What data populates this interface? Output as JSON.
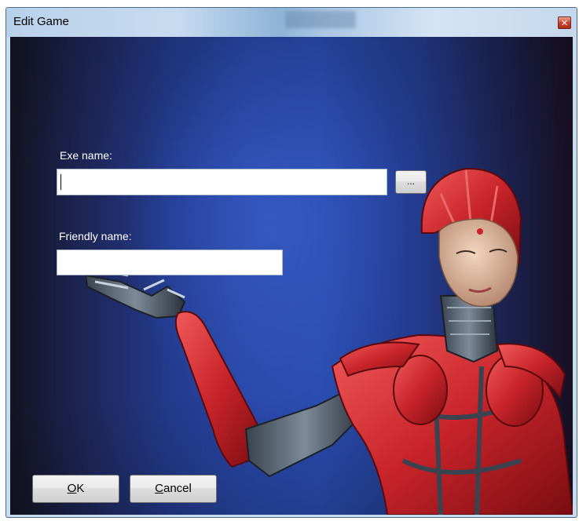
{
  "window": {
    "title": "Edit Game",
    "close_icon": "close-icon"
  },
  "form": {
    "exe_label": "Exe name:",
    "exe_value": "",
    "browse_label": "...",
    "friendly_label": "Friendly name:",
    "friendly_value": ""
  },
  "buttons": {
    "ok_mnemonic": "O",
    "ok_rest": "K",
    "cancel_mnemonic": "C",
    "cancel_rest": "ancel"
  },
  "colors": {
    "background_accent": "#2a4cb0",
    "robot_red": "#c8242a",
    "title_bar": "#c7dbf0"
  }
}
